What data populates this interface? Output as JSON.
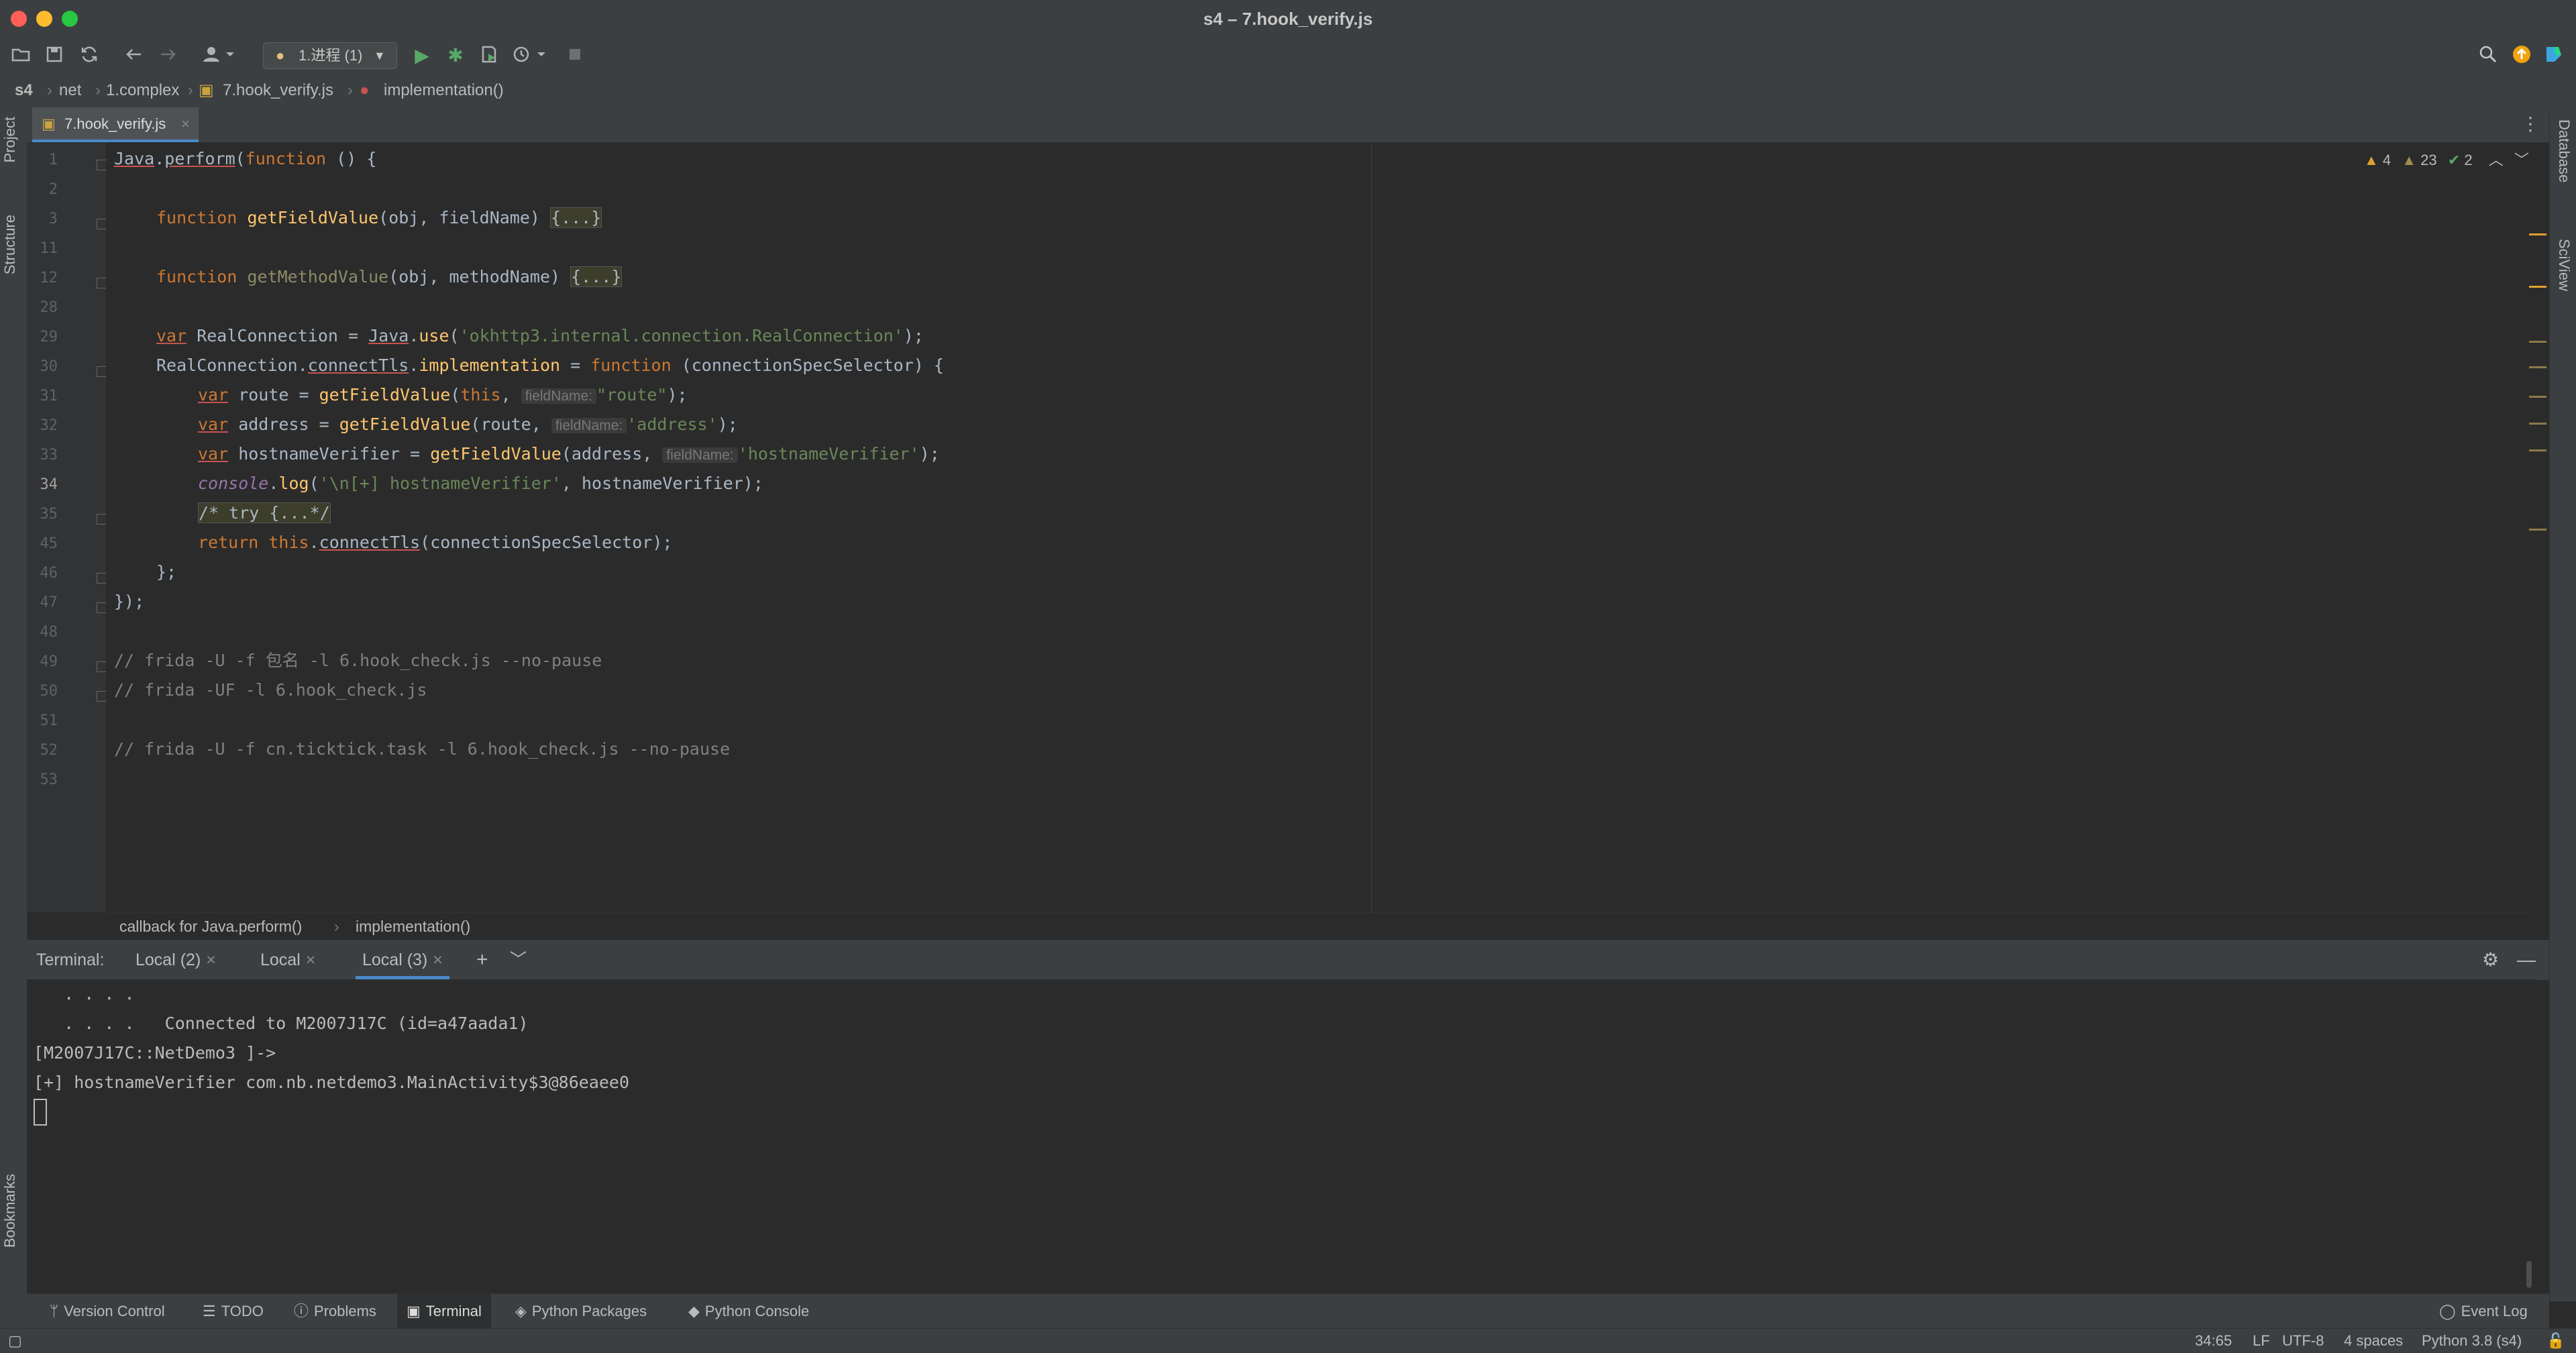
{
  "window": {
    "title": "s4 – 7.hook_verify.js"
  },
  "toolbar": {
    "run_config": "1.进程 (1)"
  },
  "breadcrumb": [
    "s4",
    "net",
    "1.complex",
    "7.hook_verify.js",
    "implementation()"
  ],
  "left_strip": {
    "project": "Project",
    "structure": "Structure",
    "bookmarks": "Bookmarks"
  },
  "right_strip": {
    "database": "Database",
    "sciview": "SciView"
  },
  "editor": {
    "tab_label": "7.hook_verify.js",
    "inspections": {
      "warnings": "4",
      "weak_warnings": "23",
      "ok": "2"
    },
    "line_numbers": [
      "1",
      "2",
      "3",
      "11",
      "12",
      "28",
      "29",
      "30",
      "31",
      "32",
      "33",
      "34",
      "35",
      "45",
      "46",
      "47",
      "48",
      "49",
      "50",
      "51",
      "52",
      "53"
    ],
    "code": {
      "l1a": "Java",
      "l1b": ".",
      "l1c": "perform",
      "l1d": "(",
      "l1e": "function",
      "l1f": " () {",
      "l3a": "function ",
      "l3b": "getFieldValue",
      "l3c": "(obj, fieldName) ",
      "l3d": "{...}",
      "l12a": "function ",
      "l12b": "getMethodValue",
      "l12c": "(obj, methodName) ",
      "l12d": "{...}",
      "l29a": "var",
      "l29b": " RealConnection = ",
      "l29c": "Java",
      "l29d": ".",
      "l29e": "use",
      "l29f": "(",
      "l29g": "'okhttp3.internal.connection.RealConnection'",
      "l29h": ");",
      "l30a": "RealConnection.",
      "l30b": "connectTls",
      "l30c": ".",
      "l30d": "implementation",
      "l30e": " = ",
      "l30f": "function",
      "l30g": " (connectionSpecSelector) {",
      "l31a": "var",
      "l31b": " route = ",
      "l31c": "getFieldValue",
      "l31d": "(",
      "l31e": "this",
      "l31f": ", ",
      "l31g": "fieldName:",
      "l31h": "\"route\"",
      "l31i": ");",
      "l32a": "var",
      "l32b": " address = ",
      "l32c": "getFieldValue",
      "l32d": "(route, ",
      "l32e": "fieldName:",
      "l32f": "'address'",
      "l32g": ");",
      "l33a": "var",
      "l33b": " hostnameVerifier = ",
      "l33c": "getFieldValue",
      "l33d": "(address, ",
      "l33e": "fieldName:",
      "l33f": "'hostnameVerifier'",
      "l33g": ");",
      "l34a": "console",
      "l34b": ".",
      "l34c": "log",
      "l34d": "(",
      "l34e": "'\\n[+] hostnameVerifier'",
      "l34f": ", hostnameVerifier);",
      "l35": "/* try {...*/",
      "l45a": "return ",
      "l45b": "this",
      "l45c": ".",
      "l45d": "connectTls",
      "l45e": "(connectionSpecSelector);",
      "l46": "};",
      "l47": "});",
      "l49": "// frida -U -f 包名 -l 6.hook_check.js --no-pause",
      "l50": "// frida -UF -l 6.hook_check.js",
      "l52": "// frida -U -f cn.ticktick.task -l 6.hook_check.js --no-pause"
    },
    "crumb": [
      "callback for Java.perform()",
      "implementation()"
    ]
  },
  "terminal": {
    "label": "Terminal:",
    "tabs": [
      "Local (2)",
      "Local",
      "Local (3)"
    ],
    "lines": [
      "   . . . .",
      "   . . . .   Connected to M2007J17C (id=a47aada1)",
      "[M2007J17C::NetDemo3 ]->",
      "[+] hostnameVerifier com.nb.netdemo3.MainActivity$3@86eaee0"
    ]
  },
  "bottom_tools": [
    "Version Control",
    "TODO",
    "Problems",
    "Terminal",
    "Python Packages",
    "Python Console",
    "Event Log"
  ],
  "status": {
    "position": "34:65",
    "line_sep": "LF",
    "encoding": "UTF-8",
    "indent": "4 spaces",
    "interpreter": "Python 3.8 (s4)"
  },
  "colors": {
    "keyword": "#cc7832",
    "function": "#ffc66d",
    "string": "#6a8759",
    "comment": "#808080",
    "accent": "#4a88c7"
  }
}
